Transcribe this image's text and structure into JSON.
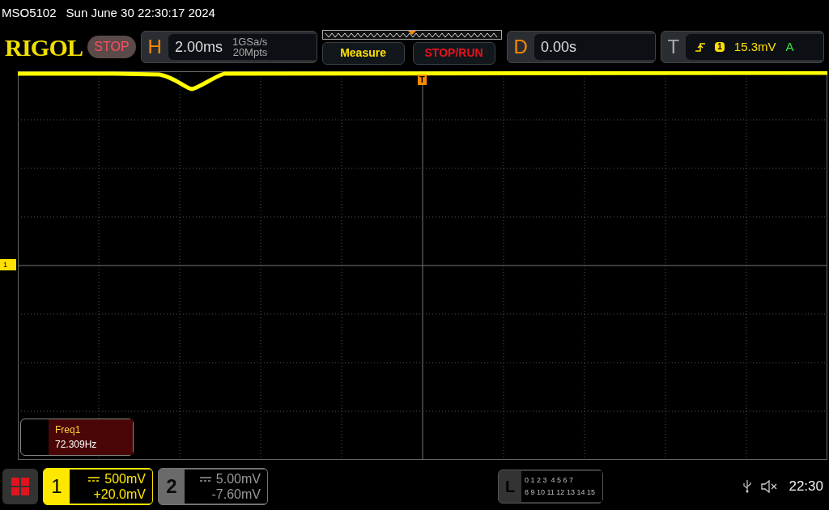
{
  "status_bar": {
    "model": "MSO5102",
    "datetime": "Sun June 30 22:30:17 2024"
  },
  "header": {
    "logo": "RIGOL",
    "run_state": "STOP",
    "horizontal": {
      "label": "H",
      "timebase": "2.00ms",
      "sample_rate": "1GSa/s",
      "memory_depth": "20Mpts"
    },
    "buttons": [
      {
        "label": "Measure",
        "color": "#ffe000"
      },
      {
        "label": "STOP/RUN",
        "color": "#e8121e"
      }
    ],
    "delay": {
      "label": "D",
      "value": "0.00s"
    },
    "trigger": {
      "label": "T",
      "source": "1",
      "level": "15.3mV",
      "mode": "A"
    }
  },
  "channel_marker": "1",
  "trigger_marker": "T",
  "measurement": {
    "name": "Freq1",
    "value": "72.309Hz"
  },
  "channels": [
    {
      "number": "1",
      "scale": "500mV",
      "offset": "+20.0mV",
      "selected": true
    },
    {
      "number": "2",
      "scale": "5.00mV",
      "offset": "-7.60mV",
      "selected": false
    }
  ],
  "logic": {
    "label": "L",
    "rows": [
      "0 1 2 3  4 5 6 7",
      "8 9 10 11 12 13 14 15"
    ]
  },
  "clock": "22:30"
}
